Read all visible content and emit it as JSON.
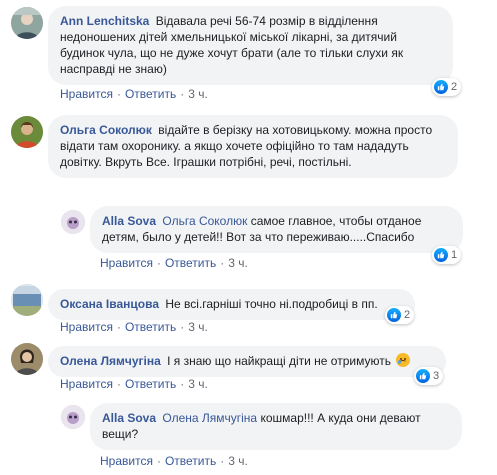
{
  "actions": {
    "like": "Нравится",
    "reply": "Ответить",
    "time": "3 ч."
  },
  "colors": {
    "bubble": "#f2f3f5",
    "name": "#385898",
    "like": "#1877f2"
  },
  "comments": [
    {
      "author": "Ann Lenchitska",
      "text": "Відавала речі 56-74 розмір в відділення недоношених дітей хмельницької міської лікарні, за дитячий будинок чула, що не дуже хочут брати (але то тільки слухи як насправді не знаю)",
      "likes": "2"
    },
    {
      "author": "Ольга Соколюк",
      "text": "відайте в берізку на хотовицькому. можна просто відати там охоронику. а якщо хочете офіційно то там нададуть довітку. Вкруть Все. Іграшки потрібні, речі, постільні."
    },
    {
      "author": "Alla Sova",
      "mention": "Ольга Соколюк",
      "text": "самое главное, чтобы отданое детям, было у детей!! Вот за что переживаю.....Спасибо",
      "likes": "1"
    },
    {
      "author": "Оксана Іванцова",
      "text": "Не всі.гарніші точно ні.подробиці в пп.",
      "likes": "2"
    },
    {
      "author": "Олена Лямчугіна",
      "text": "І я знаю що найкращі діти не отримують",
      "emoji": "crying-face-icon",
      "likes": "3"
    },
    {
      "author": "Alla Sova",
      "mention": "Олена Лямчугіна",
      "text": "кошмар!!! А куда они девают вещи?"
    }
  ]
}
